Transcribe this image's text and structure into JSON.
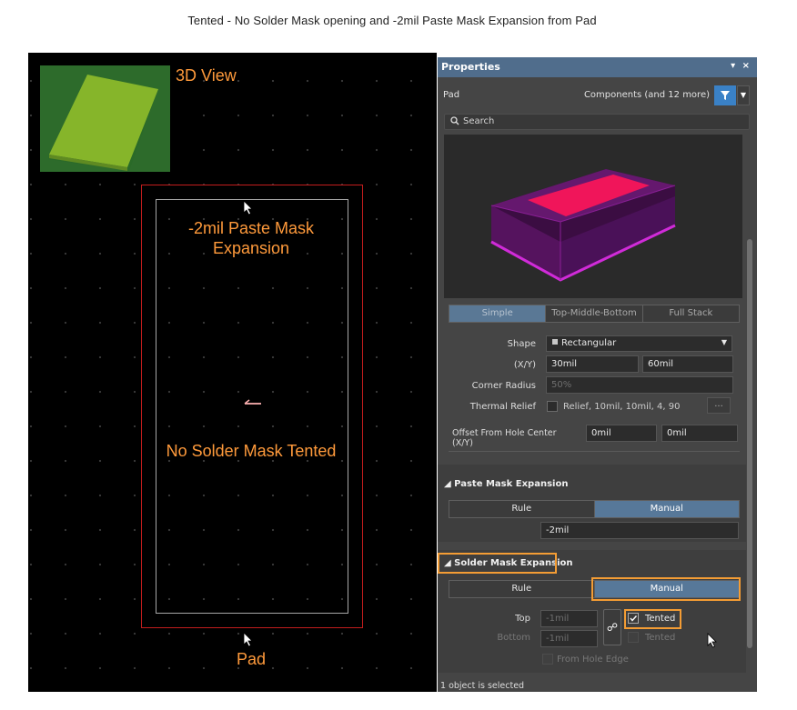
{
  "caption": "Tented - No Solder Mask opening and -2mil Paste Mask Expansion from Pad",
  "canvas": {
    "label_3d_view": "3D View",
    "label_paste": "-2mil Paste Mask Expansion",
    "label_no_solder": "No Solder Mask Tented",
    "label_pad": "Pad"
  },
  "panel": {
    "title": "Properties",
    "title_actions": "▾ ×",
    "object_kind": "Pad",
    "filter_scope": "Components (and 12 more)",
    "search_placeholder": "Search",
    "stack_tabs": [
      "Simple",
      "Top-Middle-Bottom",
      "Full Stack"
    ],
    "active_stack_tab": "Simple",
    "shape_label": "Shape",
    "shape_value": "Rectangular",
    "xy_label": "(X/Y)",
    "size_x": "30mil",
    "size_y": "60mil",
    "corner_radius_label": "Corner Radius",
    "corner_radius_value": "50%",
    "thermal_relief_label": "Thermal Relief",
    "thermal_relief_value": "Relief, 10mil, 10mil, 4, 90",
    "ellipsis": "...",
    "offset_label": "Offset From Hole Center (X/Y)",
    "offset_x": "0mil",
    "offset_y": "0mil",
    "paste_section": {
      "title": "Paste Mask Expansion",
      "mode_options": [
        "Rule",
        "Manual"
      ],
      "active_mode": "Manual",
      "value": "-2mil"
    },
    "solder_section": {
      "title": "Solder Mask Expansion",
      "mode_options": [
        "Rule",
        "Manual"
      ],
      "active_mode": "Manual",
      "top_label": "Top",
      "top_value": "-1mil",
      "bottom_label": "Bottom",
      "bottom_value": "-1mil",
      "tented_label": "Tented",
      "tented_top_checked": true,
      "tented_bottom_checked": false,
      "from_hole_edge_label": "From Hole Edge"
    },
    "status": "1 object is selected"
  },
  "colors": {
    "annotation_orange": "#ff9a3b",
    "highlight_orange": "#f39c34",
    "panel_title_blue": "#506d8c",
    "active_segment": "#577899"
  }
}
